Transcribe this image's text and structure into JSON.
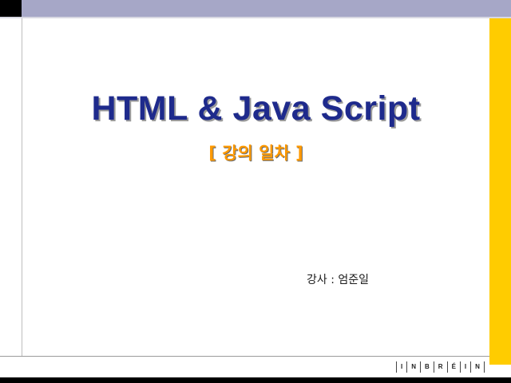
{
  "slide": {
    "title": "HTML & Java Script",
    "subtitle": "[ 강의 일차 ]",
    "instructor": "강사 : 엄준일",
    "logo_letters": [
      "I",
      "N",
      "B",
      "R",
      "É",
      "I",
      "N"
    ]
  },
  "colors": {
    "top_bar": "#a6a7c7",
    "top_corner": "#000000",
    "right_band": "#ffcc00",
    "title": "#1e2a8c",
    "subtitle": "#ff9900",
    "bottom_bar": "#000000"
  }
}
